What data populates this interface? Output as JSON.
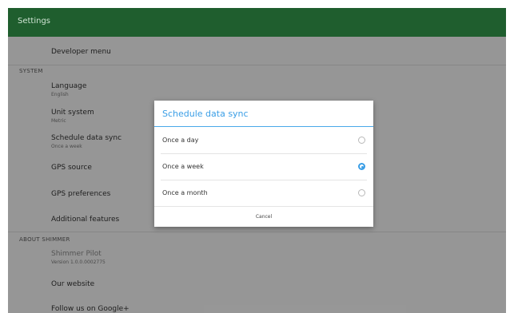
{
  "app_bar": {
    "title": "Settings"
  },
  "settings": {
    "developer_menu": "Developer menu",
    "system_header": "SYSTEM",
    "language": {
      "title": "Language",
      "value": "English"
    },
    "unit_system": {
      "title": "Unit system",
      "value": "Metric"
    },
    "schedule_data_sync": {
      "title": "Schedule data sync",
      "value": "Once a week"
    },
    "gps_source": "GPS source",
    "gps_preferences": "GPS preferences",
    "additional_features": "Additional features",
    "about_header": "ABOUT SHIMMER",
    "about_app": {
      "title": "Shimmer Pilot",
      "value": "Version 1.0.0.0002775"
    },
    "our_website": "Our website",
    "follow_google": "Follow us on Google+"
  },
  "dialog": {
    "title": "Schedule data sync",
    "options": [
      {
        "label": "Once a day",
        "selected": false
      },
      {
        "label": "Once a week",
        "selected": true
      },
      {
        "label": "Once a month",
        "selected": false
      }
    ],
    "cancel_label": "Cancel"
  },
  "colors": {
    "app_bar": "#1f5e2e",
    "accent": "#3a9ee6"
  }
}
